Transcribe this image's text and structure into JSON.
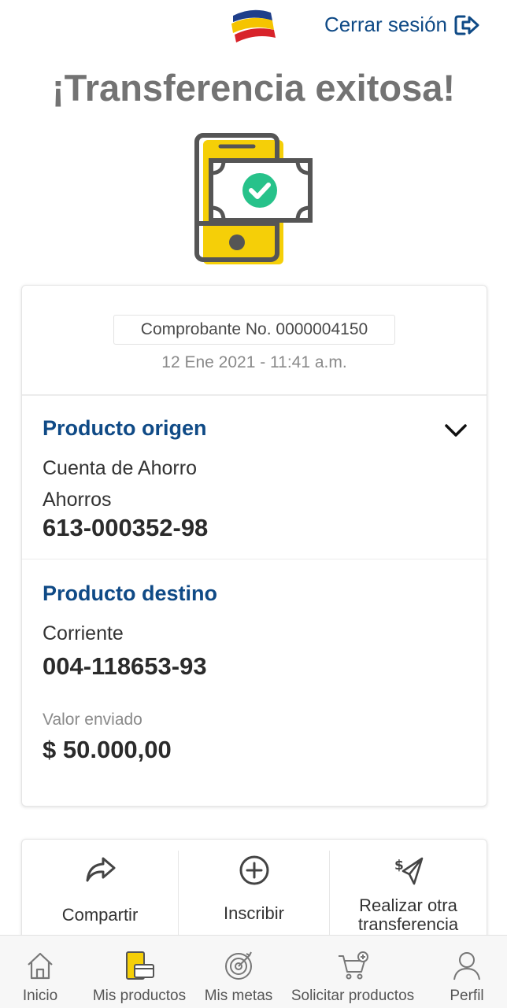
{
  "header": {
    "logout_label": "Cerrar sesión",
    "brand_colors": [
      "#f5c400",
      "#d8232a",
      "#1f3f8a"
    ],
    "accent": "#0f4a86"
  },
  "title": "¡Transferencia exitosa!",
  "receipt": {
    "number_label": "Comprobante No. 0000004150",
    "datetime": "12 Ene 2021 - 11:41 a.m."
  },
  "origin": {
    "title": "Producto origen",
    "type": "Cuenta de Ahorro",
    "subtype": "Ahorros",
    "account": "613-000352-98"
  },
  "destination": {
    "title": "Producto destino",
    "type": "Corriente",
    "account": "004-118653-93",
    "amount_label": "Valor enviado",
    "amount": "$ 50.000,00"
  },
  "actions": [
    {
      "label": "Compartir",
      "icon": "share-icon"
    },
    {
      "label": "Inscribir",
      "icon": "plus-circle-icon"
    },
    {
      "label": "Realizar otra transferencia",
      "icon": "send-money-icon"
    }
  ],
  "nav": [
    {
      "label": "Inicio",
      "icon": "home-icon"
    },
    {
      "label": "Mis productos",
      "icon": "products-icon"
    },
    {
      "label": "Mis metas",
      "icon": "target-icon"
    },
    {
      "label": "Solicitar productos",
      "icon": "cart-icon"
    },
    {
      "label": "Perfil",
      "icon": "user-icon"
    }
  ]
}
